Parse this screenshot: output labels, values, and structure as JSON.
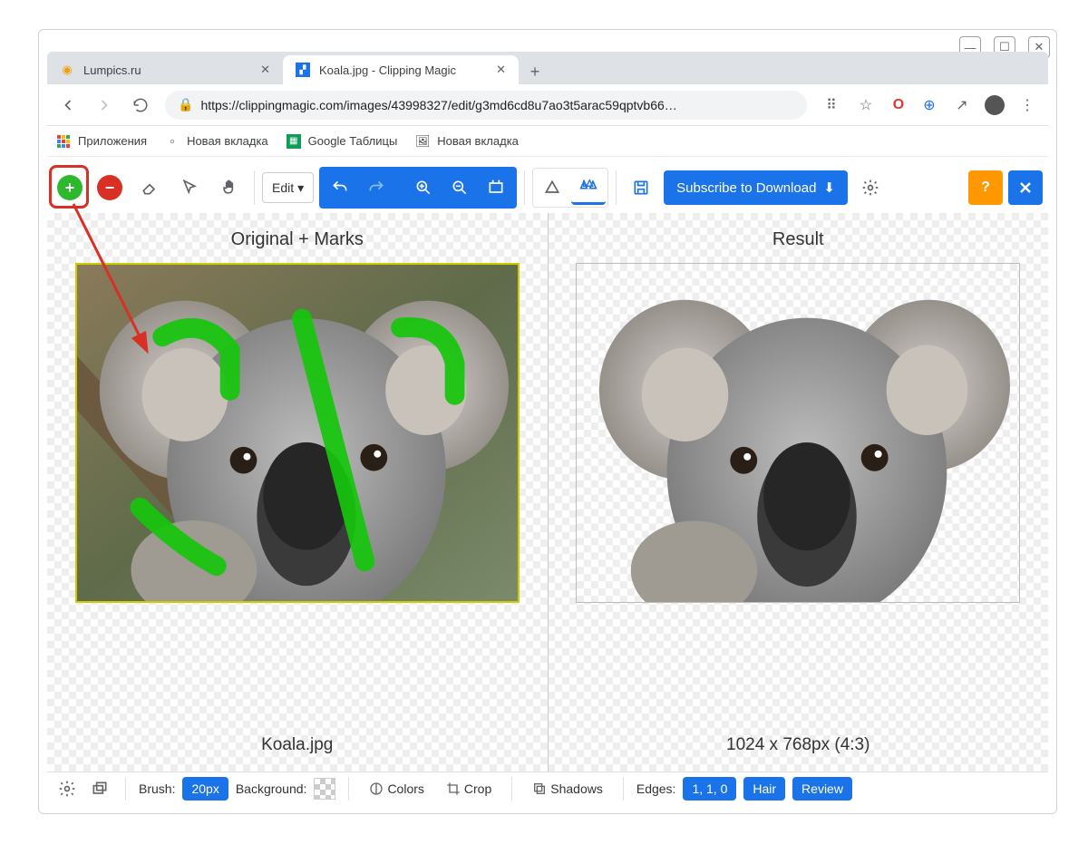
{
  "browser": {
    "tabs": [
      {
        "title": "Lumpics.ru",
        "active": false
      },
      {
        "title": "Koala.jpg - Clipping Magic",
        "active": true
      }
    ],
    "url": "https://clippingmagic.com/images/43998327/edit/g3md6cd8u7ao3t5arac59qptvb66…",
    "bookmarks": [
      {
        "label": "Приложения",
        "icon": "apps"
      },
      {
        "label": "Новая вкладка",
        "icon": "page"
      },
      {
        "label": "Google Таблицы",
        "icon": "sheets"
      },
      {
        "label": "Новая вкладка",
        "icon": "photo"
      }
    ]
  },
  "toolbar": {
    "edit_label": "Edit",
    "subscribe_label": "Subscribe to Download",
    "help_label": "?"
  },
  "panes": {
    "left_title": "Original + Marks",
    "right_title": "Result",
    "filename": "Koala.jpg",
    "dimensions": "1024 x 768px (4:3)"
  },
  "bottom": {
    "brush_label": "Brush:",
    "brush_value": "20px",
    "background_label": "Background:",
    "colors_label": "Colors",
    "crop_label": "Crop",
    "shadows_label": "Shadows",
    "edges_label": "Edges:",
    "edges_value": "1, 1, 0",
    "hair_label": "Hair",
    "review_label": "Review"
  }
}
